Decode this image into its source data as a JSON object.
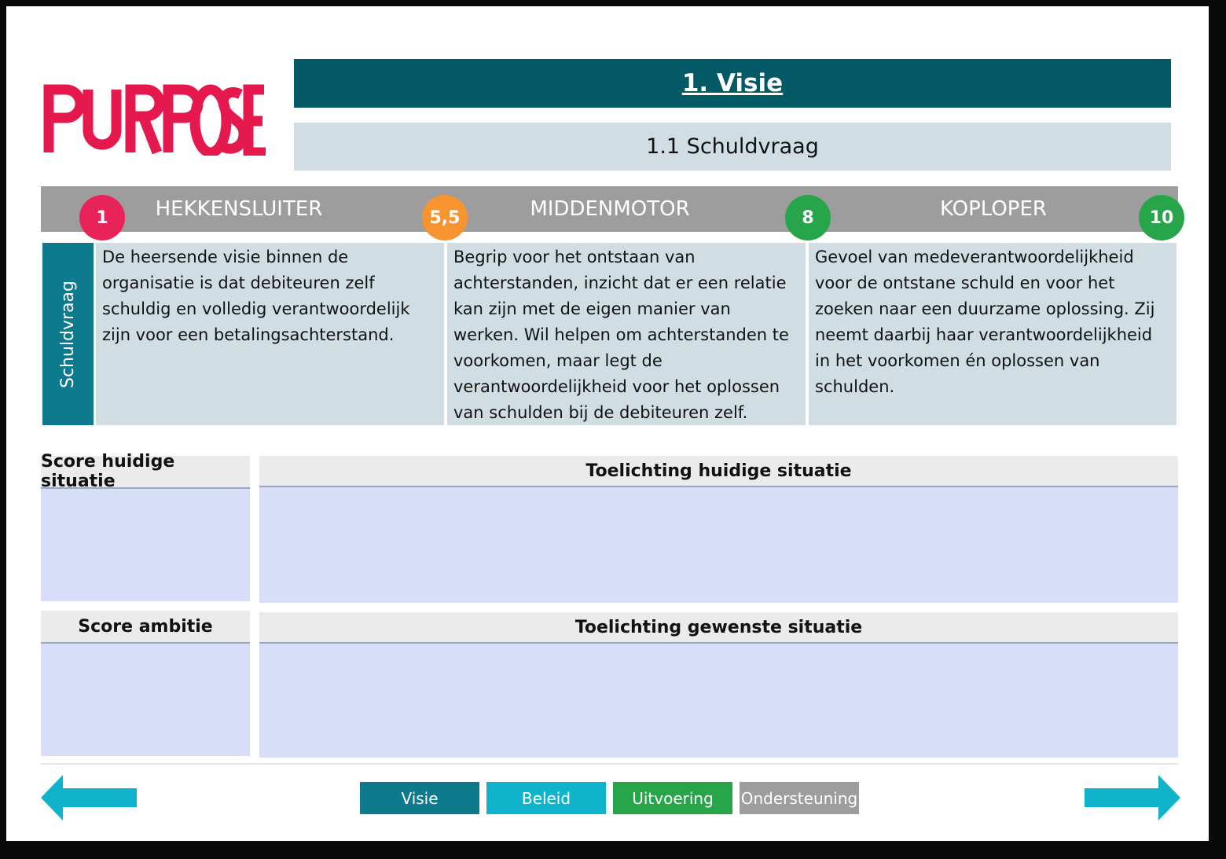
{
  "header": {
    "logo_text": "PURPOSE",
    "title": "1. Visie",
    "subtitle": "1.1 Schuldvraag"
  },
  "levels": [
    {
      "name": "HEKKENSLUITER",
      "score": "1",
      "color": "#e8235a"
    },
    {
      "name": "MIDDENMOTOR",
      "score": "5,5",
      "color": "#f7942f"
    },
    {
      "name": "KOPLOPER",
      "score": "8",
      "color": "#27a54a"
    }
  ],
  "max_score": {
    "score": "10",
    "color": "#27a54a"
  },
  "row_label": "Schuldvraag",
  "descriptions": [
    "De heersende visie binnen de organisatie is dat debiteuren zelf schuldig en volledig verantwoordelijk zijn voor een betalingsachterstand.",
    "Begrip voor het ontstaan van achterstanden, inzicht dat er een relatie kan zijn met de eigen manier van werken. Wil helpen om achterstanden te voorkomen, maar legt de verantwoordelijkheid voor het oplossen van schulden bij de debiteuren zelf.",
    "Gevoel van medeverantwoordelijkheid voor de ontstane schuld en voor het zoeken naar een duurzame oplossing. Zij neemt daarbij haar verantwoordelijkheid in het voorkomen én oplossen van schulden."
  ],
  "assessment": {
    "score_current_label": "Score huidige situatie",
    "explain_current_label": "Toelichting huidige situatie",
    "score_ambition_label": "Score ambitie",
    "explain_desired_label": "Toelichting gewenste situatie"
  },
  "nav": {
    "items": [
      {
        "label": "Visie",
        "color": "#0d7a8e"
      },
      {
        "label": "Beleid",
        "color": "#0fb4cc"
      },
      {
        "label": "Uitvoering",
        "color": "#27a54a"
      },
      {
        "label": "Ondersteuning",
        "color": "#9d9d9d"
      }
    ],
    "arrow_color": "#0fb4cc"
  },
  "brand_color": "#e5194d"
}
